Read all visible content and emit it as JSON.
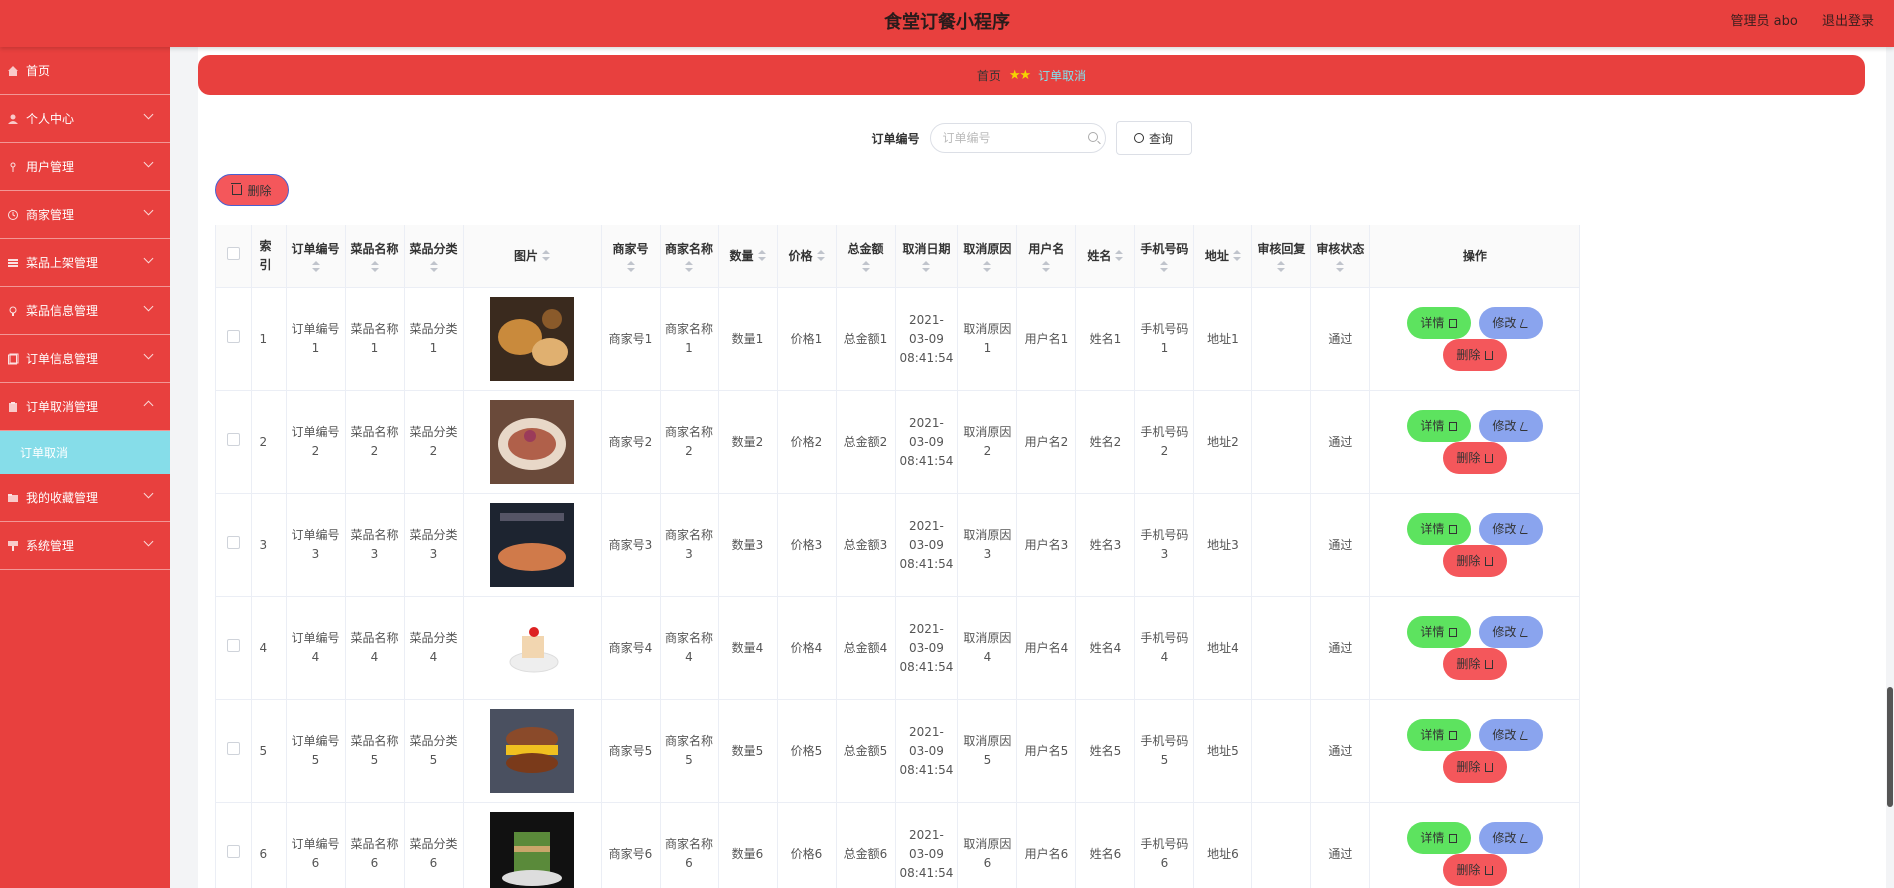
{
  "app": {
    "title": "食堂订餐小程序",
    "user": "管理员 abo",
    "logout": "退出登录"
  },
  "sidebar": {
    "items": [
      {
        "label": "首页",
        "icon": "home-icon"
      },
      {
        "label": "个人中心",
        "icon": "user-icon"
      },
      {
        "label": "用户管理",
        "icon": "people-icon"
      },
      {
        "label": "商家管理",
        "icon": "shop-icon"
      },
      {
        "label": "菜品上架管理",
        "icon": "list-icon"
      },
      {
        "label": "菜品信息管理",
        "icon": "bulb-icon"
      },
      {
        "label": "订单信息管理",
        "icon": "order-icon"
      },
      {
        "label": "订单取消管理",
        "icon": "clipboard-icon"
      },
      {
        "label": "我的收藏管理",
        "icon": "star-icon"
      },
      {
        "label": "系统管理",
        "icon": "gear-icon"
      }
    ],
    "sub_active": "订单取消"
  },
  "breadcrumb": {
    "home": "首页",
    "sep": "★★",
    "current": "订单取消"
  },
  "search": {
    "label": "订单编号",
    "placeholder": "订单编号",
    "button": "查询"
  },
  "toolbar": {
    "delete_label": "删除"
  },
  "table": {
    "headers": {
      "index": "索引",
      "order_no": "订单编号",
      "dish_name": "菜品名称",
      "dish_cat": "菜品分类",
      "image": "图片",
      "merchant_no": "商家号",
      "merchant_name": "商家名称",
      "qty": "数量",
      "price": "价格",
      "total": "总金额",
      "cancel_date": "取消日期",
      "cancel_reason": "取消原因",
      "username": "用户名",
      "name": "姓名",
      "phone": "手机号码",
      "address": "地址",
      "review_reply": "审核回复",
      "review_status": "审核状态",
      "actions": "操作"
    },
    "rows": [
      {
        "index": "1",
        "order_no": "订单编号1",
        "dish_name": "菜品名称1",
        "dish_cat": "菜品分类1",
        "merchant_no": "商家号1",
        "merchant_name": "商家名称1",
        "qty": "数量1",
        "price": "价格1",
        "total": "总金额1",
        "cancel_date": "2021-03-09 08:41:54",
        "cancel_reason": "取消原因1",
        "username": "用户名1",
        "name": "姓名1",
        "phone": "手机号码1",
        "address": "地址1",
        "review_reply": "",
        "review_status": "通过"
      },
      {
        "index": "2",
        "order_no": "订单编号2",
        "dish_name": "菜品名称2",
        "dish_cat": "菜品分类2",
        "merchant_no": "商家号2",
        "merchant_name": "商家名称2",
        "qty": "数量2",
        "price": "价格2",
        "total": "总金额2",
        "cancel_date": "2021-03-09 08:41:54",
        "cancel_reason": "取消原因2",
        "username": "用户名2",
        "name": "姓名2",
        "phone": "手机号码2",
        "address": "地址2",
        "review_reply": "",
        "review_status": "通过"
      },
      {
        "index": "3",
        "order_no": "订单编号3",
        "dish_name": "菜品名称3",
        "dish_cat": "菜品分类3",
        "merchant_no": "商家号3",
        "merchant_name": "商家名称3",
        "qty": "数量3",
        "price": "价格3",
        "total": "总金额3",
        "cancel_date": "2021-03-09 08:41:54",
        "cancel_reason": "取消原因3",
        "username": "用户名3",
        "name": "姓名3",
        "phone": "手机号码3",
        "address": "地址3",
        "review_reply": "",
        "review_status": "通过"
      },
      {
        "index": "4",
        "order_no": "订单编号4",
        "dish_name": "菜品名称4",
        "dish_cat": "菜品分类4",
        "merchant_no": "商家号4",
        "merchant_name": "商家名称4",
        "qty": "数量4",
        "price": "价格4",
        "total": "总金额4",
        "cancel_date": "2021-03-09 08:41:54",
        "cancel_reason": "取消原因4",
        "username": "用户名4",
        "name": "姓名4",
        "phone": "手机号码4",
        "address": "地址4",
        "review_reply": "",
        "review_status": "通过"
      },
      {
        "index": "5",
        "order_no": "订单编号5",
        "dish_name": "菜品名称5",
        "dish_cat": "菜品分类5",
        "merchant_no": "商家号5",
        "merchant_name": "商家名称5",
        "qty": "数量5",
        "price": "价格5",
        "total": "总金额5",
        "cancel_date": "2021-03-09 08:41:54",
        "cancel_reason": "取消原因5",
        "username": "用户名5",
        "name": "姓名5",
        "phone": "手机号码5",
        "address": "地址5",
        "review_reply": "",
        "review_status": "通过"
      },
      {
        "index": "6",
        "order_no": "订单编号6",
        "dish_name": "菜品名称6",
        "dish_cat": "菜品分类6",
        "merchant_no": "商家号6",
        "merchant_name": "商家名称6",
        "qty": "数量6",
        "price": "价格6",
        "total": "总金额6",
        "cancel_date": "2021-03-09 08:41:54",
        "cancel_reason": "取消原因6",
        "username": "用户名6",
        "name": "姓名6",
        "phone": "手机号码6",
        "address": "地址6",
        "review_reply": "",
        "review_status": "通过"
      }
    ],
    "row_actions": {
      "detail": "详情",
      "edit": "修改",
      "delete": "删除"
    }
  },
  "colors": {
    "primary": "#e8403e",
    "submenu_active": "#86dde9",
    "detail": "#5de35f",
    "edit": "#8aa4ee",
    "delete": "#f4575b"
  }
}
